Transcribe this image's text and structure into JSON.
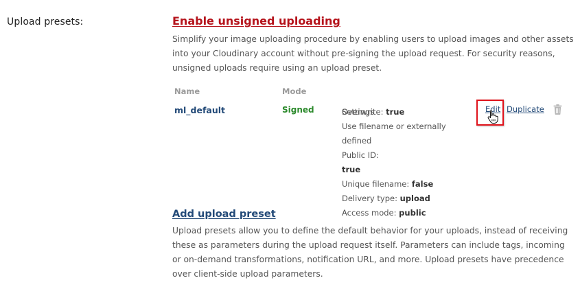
{
  "section": {
    "label": "Upload presets:"
  },
  "enable": {
    "link": "Enable unsigned uploading",
    "description": "Simplify your image uploading procedure by enabling users to upload images and other assets into your Cloudinary account without pre-signing the upload request. For security reasons, unsigned uploads require using an upload preset."
  },
  "table": {
    "headers": {
      "name": "Name",
      "mode": "Mode",
      "settings": "Settings"
    },
    "row": {
      "name": "ml_default",
      "mode": "Signed",
      "settings": {
        "overwrite_label": "Overwrite:",
        "overwrite_value": "true",
        "filename_label_1": "Use filename or externally defined",
        "filename_label_2": "Public ID:",
        "filename_value": "true",
        "unique_label": "Unique filename:",
        "unique_value": "false",
        "delivery_label": "Delivery type:",
        "delivery_value": "upload",
        "access_label": "Access mode:",
        "access_value": "public"
      },
      "actions": {
        "edit": "Edit",
        "duplicate": "Duplicate"
      }
    }
  },
  "add": {
    "link": "Add upload preset",
    "description": "Upload presets allow you to define the default behavior for your uploads, instead of receiving these as parameters during the upload request itself. Parameters can include tags, incoming or on-demand transformations, notification URL, and more. Upload presets have precedence over client-side upload parameters."
  },
  "colors": {
    "enable_link": "#b5131b",
    "link": "#234a78",
    "signed": "#2c8a2c",
    "highlight": "#e0121b"
  },
  "icons": {
    "delete": "trash-icon",
    "cursor": "hand-pointer-cursor-icon"
  }
}
